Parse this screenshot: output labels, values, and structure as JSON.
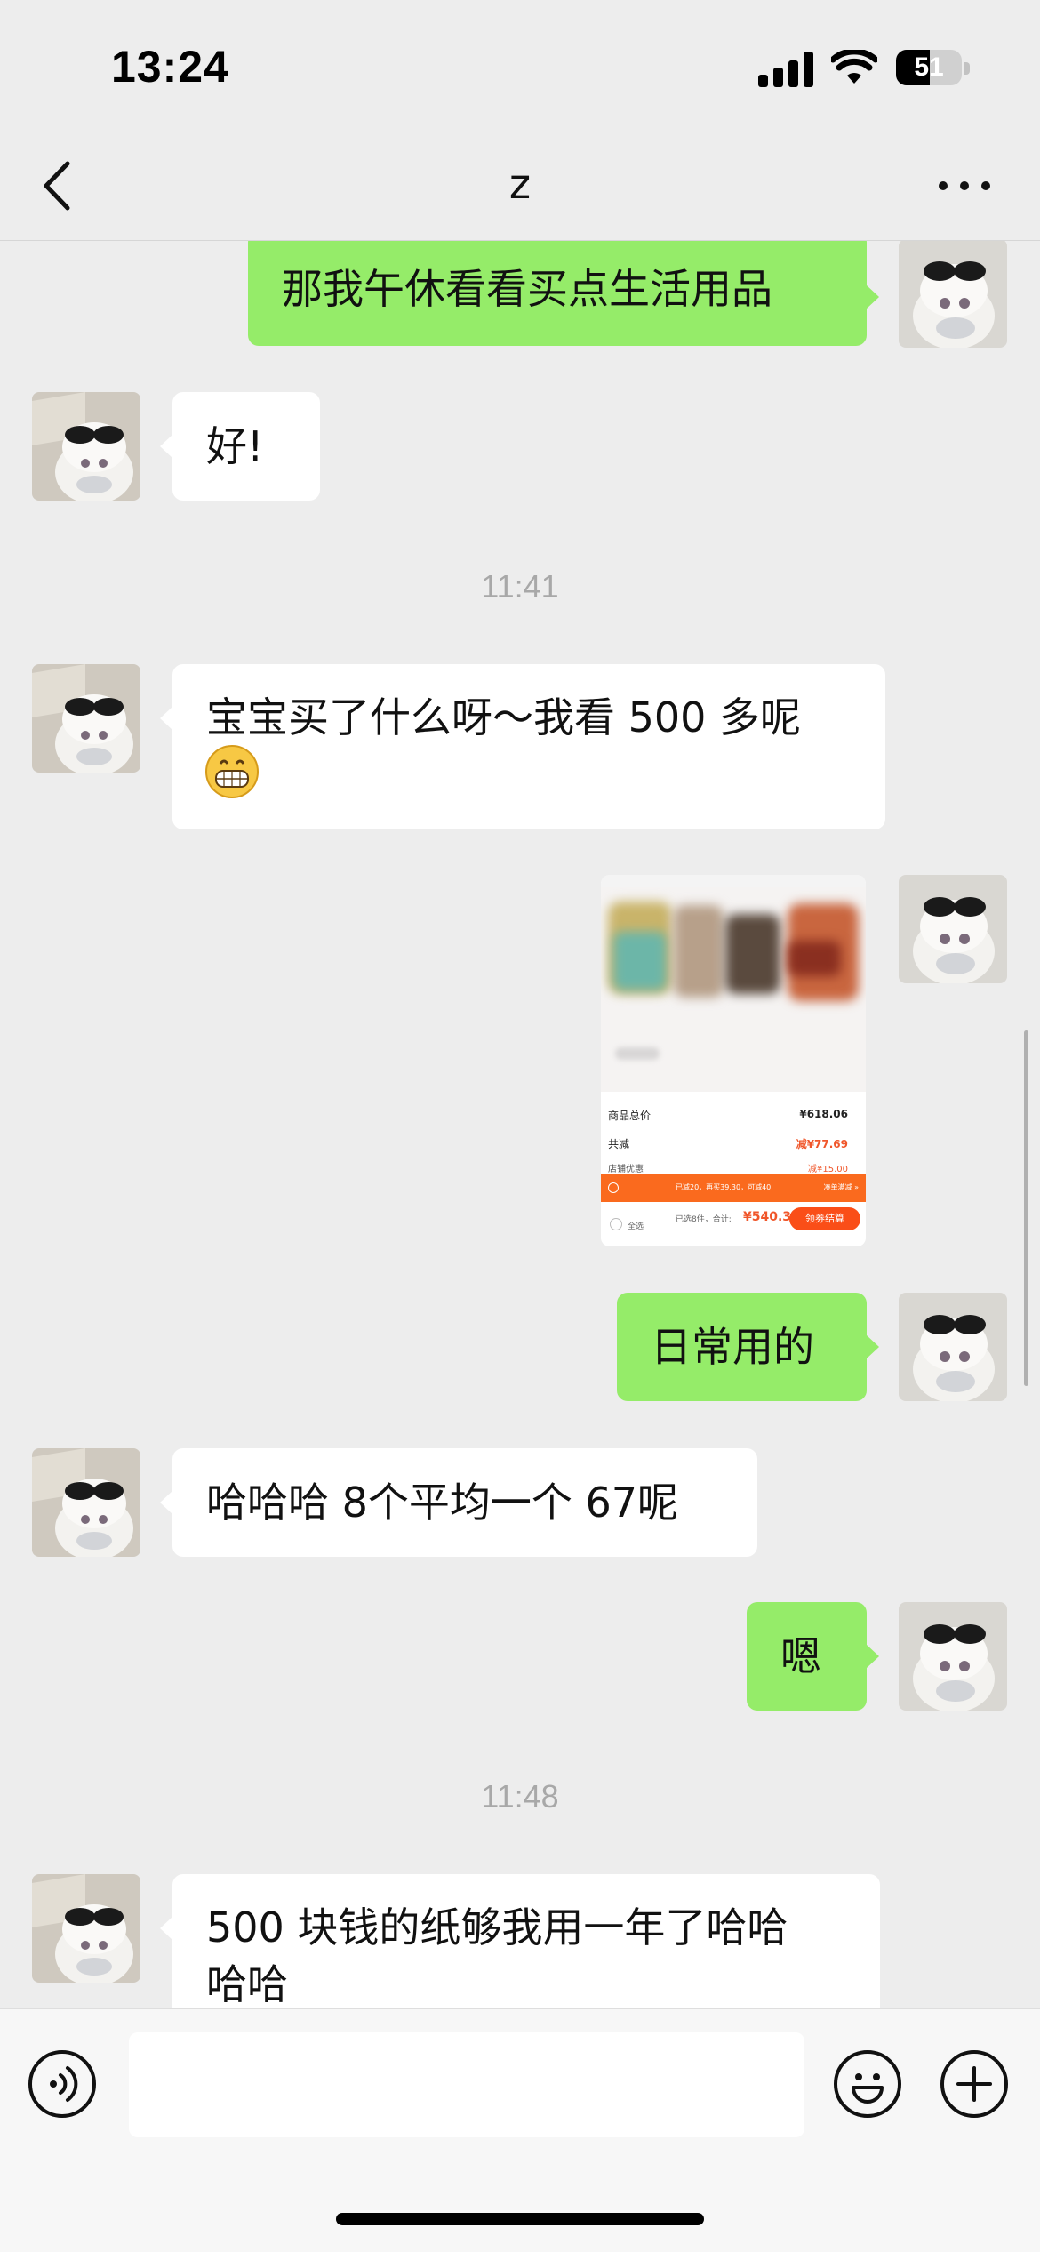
{
  "status": {
    "time": "13:24",
    "battery": "51",
    "battery_level": 0.51
  },
  "header": {
    "title": "z"
  },
  "messages": {
    "m1": "那我午休看看买点生活用品",
    "m2": "好!",
    "t1": "11:41",
    "m3_line1": "宝宝买了什么呀～我看 500 多呢",
    "m3_emoji": "😁",
    "m4_total_label": "商品总价",
    "m4_total": "¥618.06",
    "m4_discount_label": "共减",
    "m4_discount": "减¥77.69",
    "m4_shop_label": "店铺优惠",
    "m4_shop": "减¥15.00",
    "m4_promo": "已减20，再买39.30，可减40",
    "m4_promo_link": "凑单满减 »",
    "m4_selected": "已选8件，合计:",
    "m4_sum": "¥540.37",
    "m4_checkout": "领券结算",
    "m4_all": "全选",
    "m5": "日常用的",
    "m6": "哈哈哈 8个平均一个 67呢",
    "m7": "嗯",
    "t2": "11:48",
    "m8_line1": "500 块钱的纸够我用一年了哈哈",
    "m8_line2": "哈哈"
  }
}
